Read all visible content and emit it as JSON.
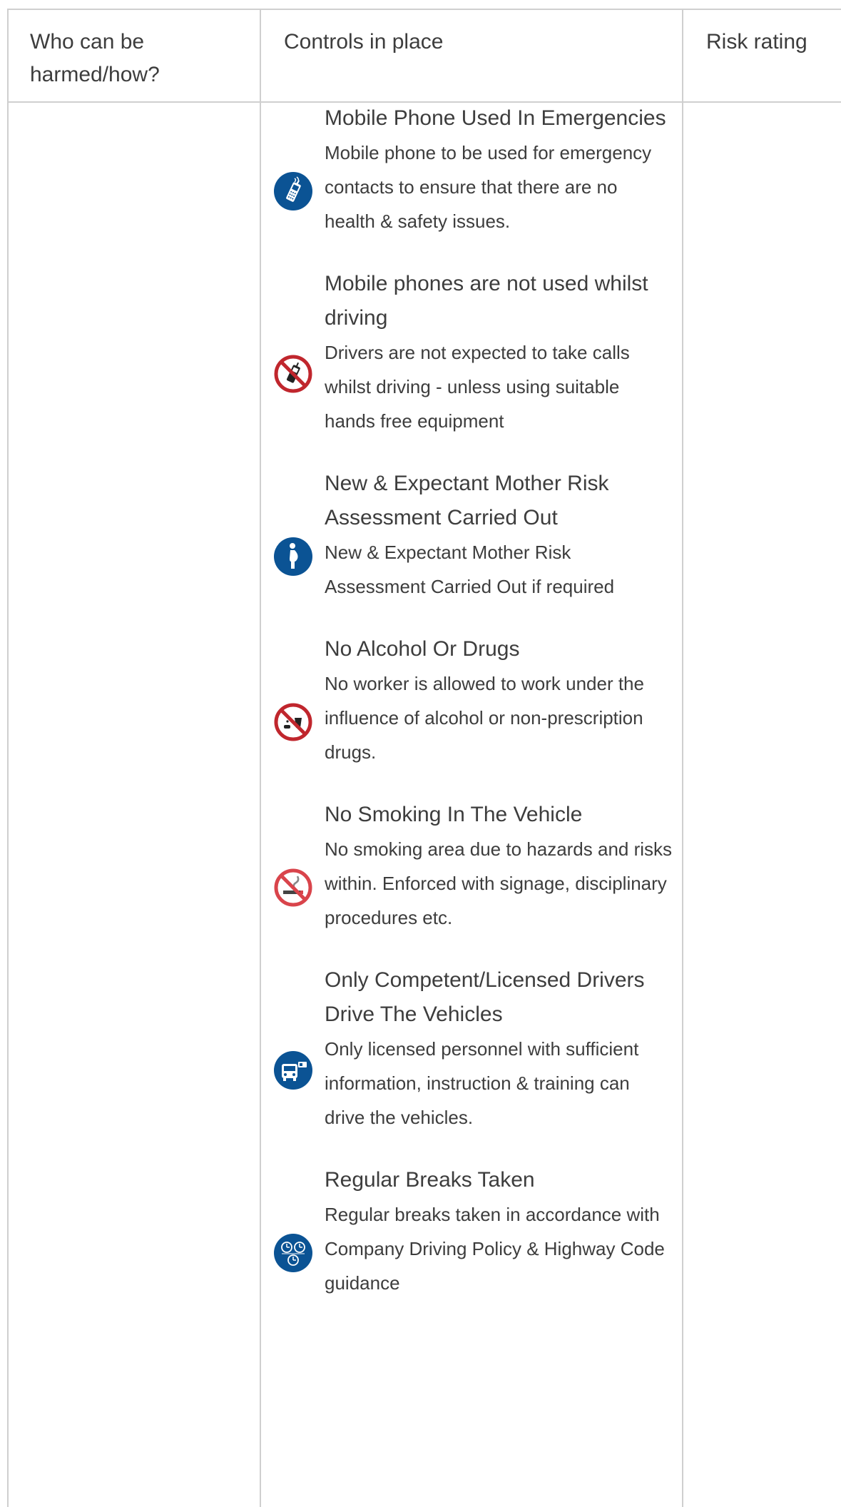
{
  "table": {
    "headers": {
      "who": "Who can be harmed/how?",
      "controls": "Controls in place",
      "risk": "Risk rating"
    }
  },
  "controls": [
    {
      "title": "Mobile Phone Used In Emergencies",
      "description": "Mobile phone to be used for emergency contacts to ensure that there are no health & safety issues.",
      "icon": "mobile-phone-icon"
    },
    {
      "title": "Mobile phones are not used whilst driving",
      "description": "Drivers are not expected to take calls whilst driving - unless using suitable hands free equipment",
      "icon": "no-mobile-phone-icon"
    },
    {
      "title": "New & Expectant Mother Risk Assessment Carried Out",
      "description": "New & Expectant Mother Risk Assessment Carried Out if required",
      "icon": "pregnant-woman-icon"
    },
    {
      "title": "No Alcohol Or Drugs",
      "description": "No worker is allowed to work under the influence of alcohol or non-prescription drugs.",
      "icon": "no-alcohol-drugs-icon"
    },
    {
      "title": "No Smoking In The Vehicle",
      "description": "No smoking area due to hazards and risks within. Enforced with signage, disciplinary procedures etc.",
      "icon": "no-smoking-icon"
    },
    {
      "title": "Only Competent/Licensed Drivers Drive The Vehicles",
      "description": "Only licensed personnel with sufficient information, instruction & training can drive the vehicles.",
      "icon": "licensed-driver-icon"
    },
    {
      "title": "Regular Breaks Taken",
      "description": "Regular breaks taken in accordance with Company Driving Policy & Highway Code guidance",
      "icon": "regular-breaks-icon"
    }
  ],
  "colors": {
    "mandatory_blue": "#0b5394",
    "prohibition_red": "#c0262d",
    "border": "#cfcfcf"
  }
}
